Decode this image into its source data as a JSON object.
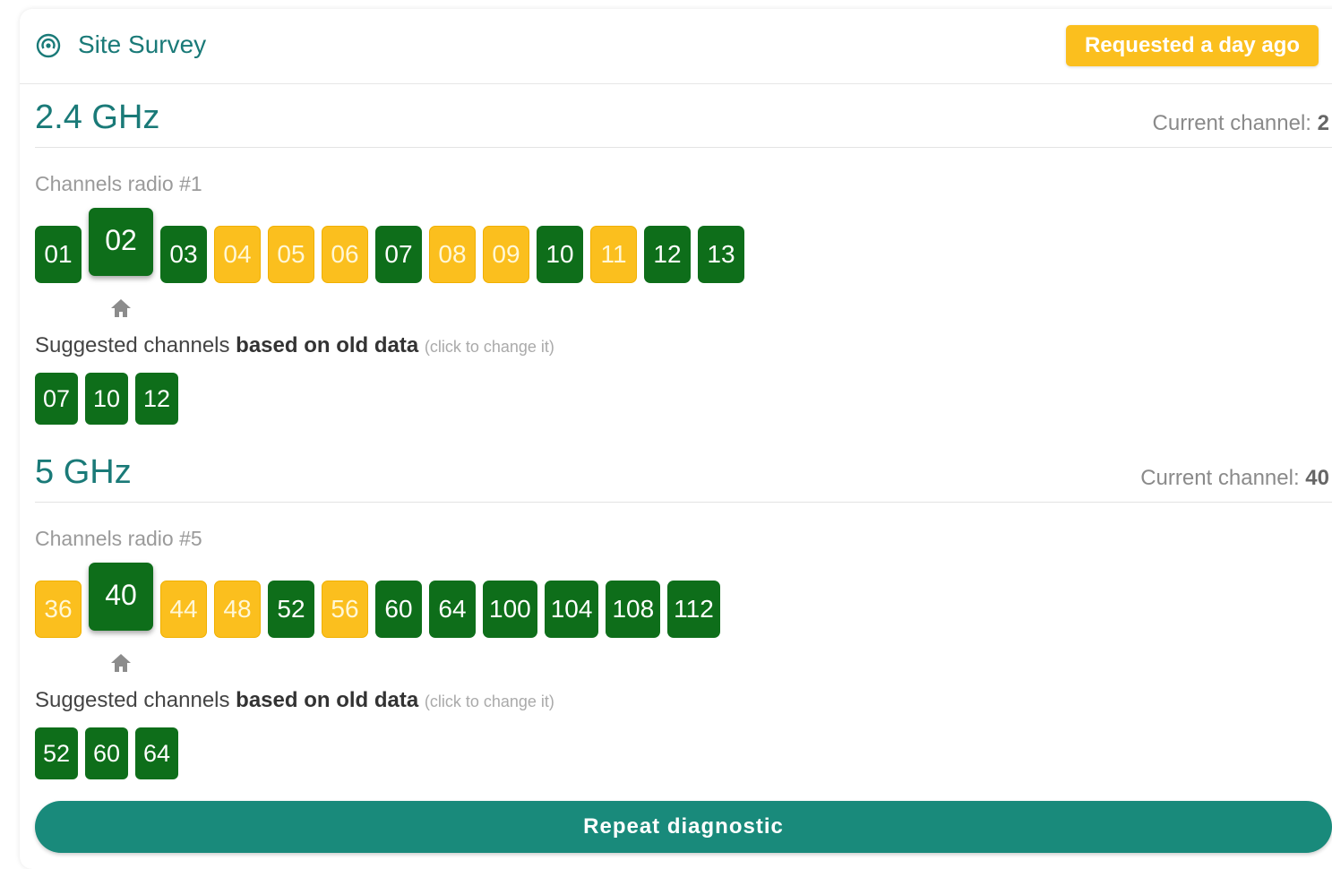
{
  "header": {
    "title": "Site Survey",
    "icon": "signal-icon",
    "badge": "Requested a day ago"
  },
  "bands": [
    {
      "title": "2.4 GHz",
      "current_channel_label": "Current channel:",
      "current_channel_value": "2",
      "radio_label": "Channels radio #1",
      "channels": [
        {
          "label": "01",
          "status": "good"
        },
        {
          "label": "02",
          "status": "good",
          "current": true
        },
        {
          "label": "03",
          "status": "good"
        },
        {
          "label": "04",
          "status": "warn"
        },
        {
          "label": "05",
          "status": "warn"
        },
        {
          "label": "06",
          "status": "warn"
        },
        {
          "label": "07",
          "status": "good"
        },
        {
          "label": "08",
          "status": "warn"
        },
        {
          "label": "09",
          "status": "warn"
        },
        {
          "label": "10",
          "status": "good"
        },
        {
          "label": "11",
          "status": "warn"
        },
        {
          "label": "12",
          "status": "good"
        },
        {
          "label": "13",
          "status": "good"
        }
      ],
      "suggest_label_plain": "Suggested channels ",
      "suggest_label_bold": "based on old data",
      "suggest_hint": "(click to change it)",
      "suggested": [
        "07",
        "10",
        "12"
      ]
    },
    {
      "title": "5 GHz",
      "current_channel_label": "Current channel:",
      "current_channel_value": "40",
      "radio_label": "Channels radio #5",
      "channels": [
        {
          "label": "36",
          "status": "warn"
        },
        {
          "label": "40",
          "status": "good",
          "current": true
        },
        {
          "label": "44",
          "status": "warn"
        },
        {
          "label": "48",
          "status": "warn"
        },
        {
          "label": "52",
          "status": "good"
        },
        {
          "label": "56",
          "status": "warn"
        },
        {
          "label": "60",
          "status": "good"
        },
        {
          "label": "64",
          "status": "good"
        },
        {
          "label": "100",
          "status": "good"
        },
        {
          "label": "104",
          "status": "good"
        },
        {
          "label": "108",
          "status": "good"
        },
        {
          "label": "112",
          "status": "good"
        }
      ],
      "suggest_label_plain": "Suggested channels ",
      "suggest_label_bold": "based on old data",
      "suggest_hint": "(click to change it)",
      "suggested": [
        "52",
        "60",
        "64"
      ]
    }
  ],
  "actions": {
    "repeat_label": "Repeat diagnostic"
  },
  "colors": {
    "good": "#0e6e1a",
    "warn": "#fbbf1e",
    "accent": "#198a7b",
    "title": "#1a7a78"
  }
}
